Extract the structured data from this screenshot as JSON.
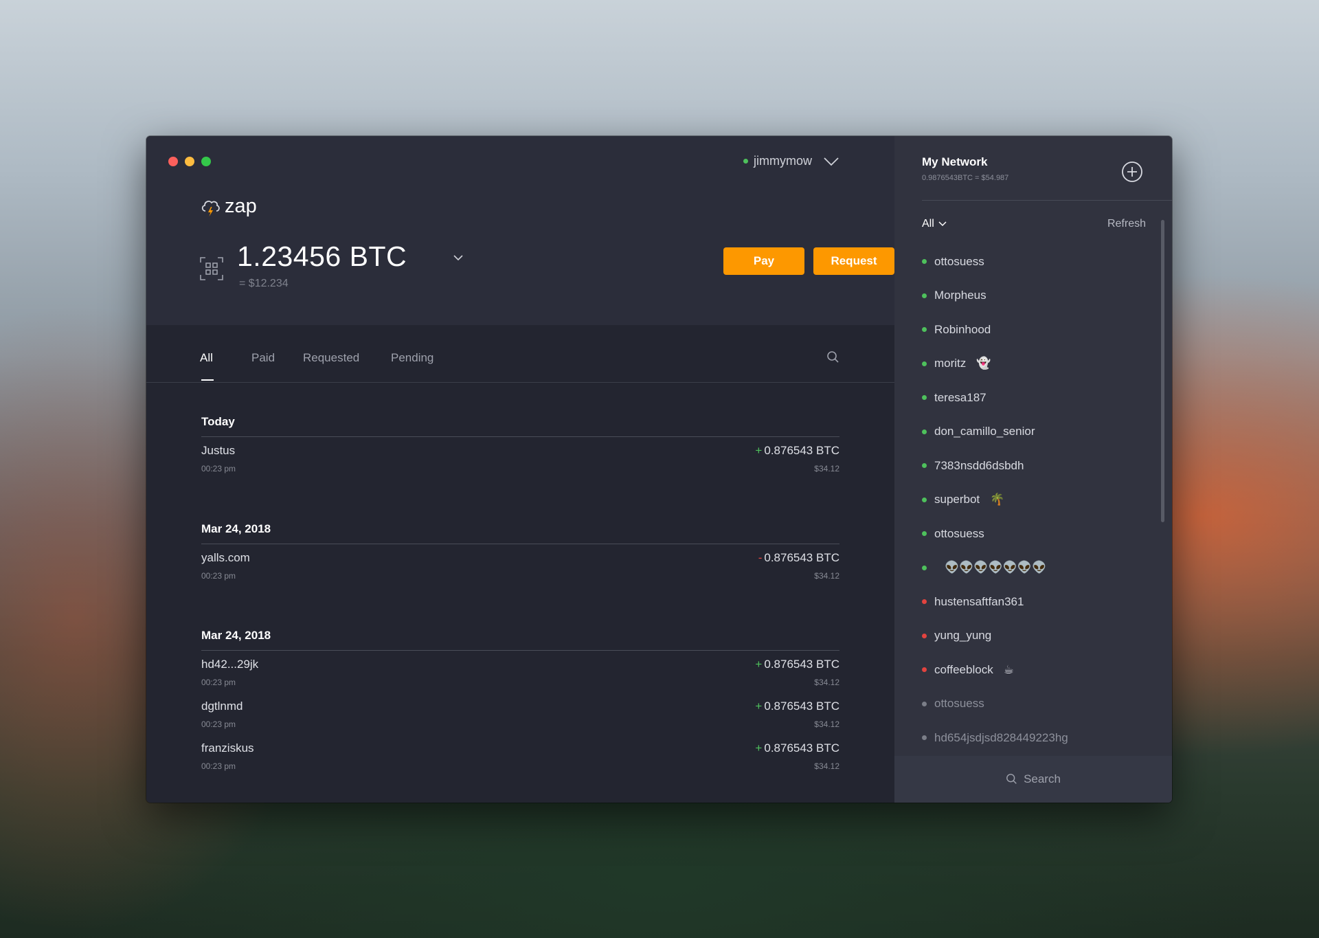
{
  "user": {
    "name": "jimmymow",
    "status": "online"
  },
  "brand": {
    "name": "zap",
    "accent": "#fd9800"
  },
  "balance": {
    "amount": "1.23456 BTC",
    "fiat": "= $12.234"
  },
  "actions": {
    "pay": "Pay",
    "request": "Request"
  },
  "tabs": [
    {
      "label": "All",
      "active": true
    },
    {
      "label": "Paid"
    },
    {
      "label": "Requested"
    },
    {
      "label": "Pending"
    }
  ],
  "sections": [
    {
      "title": "Today",
      "transactions": [
        {
          "name": "Justus",
          "time": "00:23 pm",
          "sign": "+",
          "amount": "0.876543 BTC",
          "usd": "$34.12"
        }
      ]
    },
    {
      "title": "Mar 24, 2018",
      "transactions": [
        {
          "name": "yalls.com",
          "time": "00:23 pm",
          "sign": "-",
          "amount": "0.876543 BTC",
          "usd": "$34.12"
        }
      ]
    },
    {
      "title": "Mar 24, 2018",
      "transactions": [
        {
          "name": "hd42...29jk",
          "time": "00:23 pm",
          "sign": "+",
          "amount": "0.876543 BTC",
          "usd": "$34.12"
        },
        {
          "name": "dgtlnmd",
          "time": "00:23 pm",
          "sign": "+",
          "amount": "0.876543 BTC",
          "usd": "$34.12"
        },
        {
          "name": "franziskus",
          "time": "00:23 pm",
          "sign": "+",
          "amount": "0.876543 BTC",
          "usd": "$34.12"
        }
      ]
    }
  ],
  "network": {
    "title": "My Network",
    "subtitle": "0.9876543BTC = $54.987",
    "filter": "All",
    "refresh": "Refresh",
    "search": "Search",
    "contacts": [
      {
        "name": "ottosuess",
        "status": "online"
      },
      {
        "name": "Morpheus",
        "status": "online"
      },
      {
        "name": "Robinhood",
        "status": "online"
      },
      {
        "name": "moritz",
        "emoji": "👻",
        "status": "online"
      },
      {
        "name": "teresa187",
        "status": "online"
      },
      {
        "name": "don_camillo_senior",
        "status": "online"
      },
      {
        "name": "7383nsdd6dsbdh",
        "status": "online"
      },
      {
        "name": "superbot",
        "emoji": "🌴",
        "status": "online"
      },
      {
        "name": "ottosuess",
        "status": "online"
      },
      {
        "name": "",
        "emoji": "👽👽👽👽👽👽👽",
        "status": "online"
      },
      {
        "name": "hustensaftfan361",
        "status": "offline"
      },
      {
        "name": "yung_yung",
        "status": "offline"
      },
      {
        "name": "coffeeblock",
        "emoji": "☕",
        "status": "offline"
      },
      {
        "name": "ottosuess",
        "status": "idle"
      },
      {
        "name": "hd654jsdjsd828449223hg",
        "status": "idle"
      }
    ]
  }
}
